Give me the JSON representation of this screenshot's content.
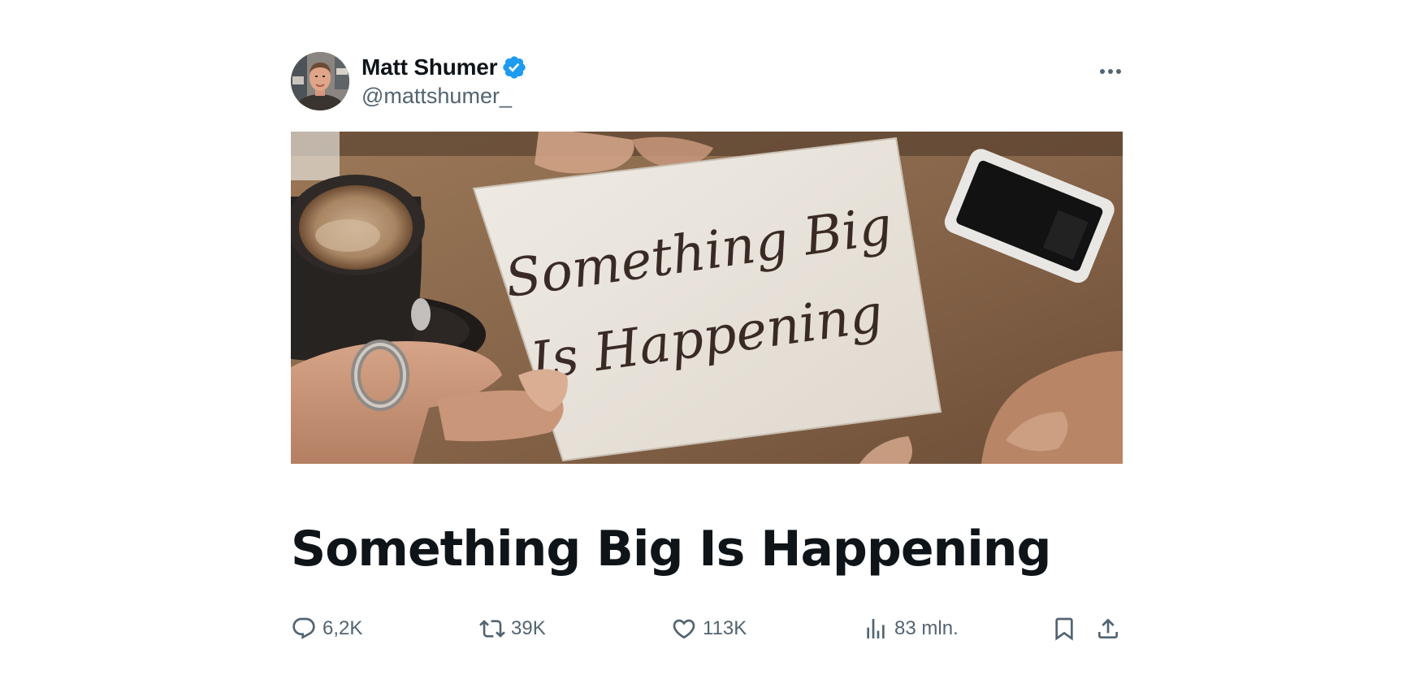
{
  "post": {
    "author": {
      "display_name": "Matt Shumer",
      "handle": "@mattshumer_",
      "verified": true,
      "avatar_icon": "profile-photo"
    },
    "more_icon": "more-dots-icon",
    "media": {
      "handwritten_line_1": "Something Big",
      "handwritten_line_2": "Is Happening"
    },
    "title": "Something Big Is Happening",
    "actions": {
      "reply": {
        "icon": "reply-bubble-icon",
        "count": "6,2K"
      },
      "repost": {
        "icon": "repost-arrows-icon",
        "count": "39K"
      },
      "like": {
        "icon": "heart-icon",
        "count": "113K"
      },
      "views": {
        "icon": "bar-chart-icon",
        "count": "83 mln."
      },
      "bookmark": {
        "icon": "bookmark-icon"
      },
      "share": {
        "icon": "share-upload-icon"
      }
    }
  },
  "colors": {
    "text_primary": "#0f1419",
    "text_secondary": "#536471",
    "verified_blue": "#1d9bf0"
  }
}
